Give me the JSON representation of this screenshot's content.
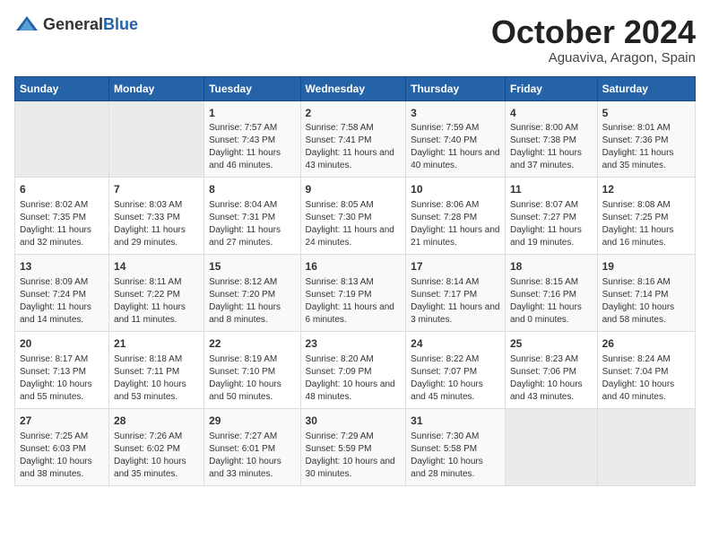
{
  "header": {
    "logo_general": "General",
    "logo_blue": "Blue",
    "month": "October 2024",
    "location": "Aguaviva, Aragon, Spain"
  },
  "days_of_week": [
    "Sunday",
    "Monday",
    "Tuesday",
    "Wednesday",
    "Thursday",
    "Friday",
    "Saturday"
  ],
  "weeks": [
    [
      {
        "day": "",
        "sunrise": "",
        "sunset": "",
        "daylight": ""
      },
      {
        "day": "",
        "sunrise": "",
        "sunset": "",
        "daylight": ""
      },
      {
        "day": "1",
        "sunrise": "Sunrise: 7:57 AM",
        "sunset": "Sunset: 7:43 PM",
        "daylight": "Daylight: 11 hours and 46 minutes."
      },
      {
        "day": "2",
        "sunrise": "Sunrise: 7:58 AM",
        "sunset": "Sunset: 7:41 PM",
        "daylight": "Daylight: 11 hours and 43 minutes."
      },
      {
        "day": "3",
        "sunrise": "Sunrise: 7:59 AM",
        "sunset": "Sunset: 7:40 PM",
        "daylight": "Daylight: 11 hours and 40 minutes."
      },
      {
        "day": "4",
        "sunrise": "Sunrise: 8:00 AM",
        "sunset": "Sunset: 7:38 PM",
        "daylight": "Daylight: 11 hours and 37 minutes."
      },
      {
        "day": "5",
        "sunrise": "Sunrise: 8:01 AM",
        "sunset": "Sunset: 7:36 PM",
        "daylight": "Daylight: 11 hours and 35 minutes."
      }
    ],
    [
      {
        "day": "6",
        "sunrise": "Sunrise: 8:02 AM",
        "sunset": "Sunset: 7:35 PM",
        "daylight": "Daylight: 11 hours and 32 minutes."
      },
      {
        "day": "7",
        "sunrise": "Sunrise: 8:03 AM",
        "sunset": "Sunset: 7:33 PM",
        "daylight": "Daylight: 11 hours and 29 minutes."
      },
      {
        "day": "8",
        "sunrise": "Sunrise: 8:04 AM",
        "sunset": "Sunset: 7:31 PM",
        "daylight": "Daylight: 11 hours and 27 minutes."
      },
      {
        "day": "9",
        "sunrise": "Sunrise: 8:05 AM",
        "sunset": "Sunset: 7:30 PM",
        "daylight": "Daylight: 11 hours and 24 minutes."
      },
      {
        "day": "10",
        "sunrise": "Sunrise: 8:06 AM",
        "sunset": "Sunset: 7:28 PM",
        "daylight": "Daylight: 11 hours and 21 minutes."
      },
      {
        "day": "11",
        "sunrise": "Sunrise: 8:07 AM",
        "sunset": "Sunset: 7:27 PM",
        "daylight": "Daylight: 11 hours and 19 minutes."
      },
      {
        "day": "12",
        "sunrise": "Sunrise: 8:08 AM",
        "sunset": "Sunset: 7:25 PM",
        "daylight": "Daylight: 11 hours and 16 minutes."
      }
    ],
    [
      {
        "day": "13",
        "sunrise": "Sunrise: 8:09 AM",
        "sunset": "Sunset: 7:24 PM",
        "daylight": "Daylight: 11 hours and 14 minutes."
      },
      {
        "day": "14",
        "sunrise": "Sunrise: 8:11 AM",
        "sunset": "Sunset: 7:22 PM",
        "daylight": "Daylight: 11 hours and 11 minutes."
      },
      {
        "day": "15",
        "sunrise": "Sunrise: 8:12 AM",
        "sunset": "Sunset: 7:20 PM",
        "daylight": "Daylight: 11 hours and 8 minutes."
      },
      {
        "day": "16",
        "sunrise": "Sunrise: 8:13 AM",
        "sunset": "Sunset: 7:19 PM",
        "daylight": "Daylight: 11 hours and 6 minutes."
      },
      {
        "day": "17",
        "sunrise": "Sunrise: 8:14 AM",
        "sunset": "Sunset: 7:17 PM",
        "daylight": "Daylight: 11 hours and 3 minutes."
      },
      {
        "day": "18",
        "sunrise": "Sunrise: 8:15 AM",
        "sunset": "Sunset: 7:16 PM",
        "daylight": "Daylight: 11 hours and 0 minutes."
      },
      {
        "day": "19",
        "sunrise": "Sunrise: 8:16 AM",
        "sunset": "Sunset: 7:14 PM",
        "daylight": "Daylight: 10 hours and 58 minutes."
      }
    ],
    [
      {
        "day": "20",
        "sunrise": "Sunrise: 8:17 AM",
        "sunset": "Sunset: 7:13 PM",
        "daylight": "Daylight: 10 hours and 55 minutes."
      },
      {
        "day": "21",
        "sunrise": "Sunrise: 8:18 AM",
        "sunset": "Sunset: 7:11 PM",
        "daylight": "Daylight: 10 hours and 53 minutes."
      },
      {
        "day": "22",
        "sunrise": "Sunrise: 8:19 AM",
        "sunset": "Sunset: 7:10 PM",
        "daylight": "Daylight: 10 hours and 50 minutes."
      },
      {
        "day": "23",
        "sunrise": "Sunrise: 8:20 AM",
        "sunset": "Sunset: 7:09 PM",
        "daylight": "Daylight: 10 hours and 48 minutes."
      },
      {
        "day": "24",
        "sunrise": "Sunrise: 8:22 AM",
        "sunset": "Sunset: 7:07 PM",
        "daylight": "Daylight: 10 hours and 45 minutes."
      },
      {
        "day": "25",
        "sunrise": "Sunrise: 8:23 AM",
        "sunset": "Sunset: 7:06 PM",
        "daylight": "Daylight: 10 hours and 43 minutes."
      },
      {
        "day": "26",
        "sunrise": "Sunrise: 8:24 AM",
        "sunset": "Sunset: 7:04 PM",
        "daylight": "Daylight: 10 hours and 40 minutes."
      }
    ],
    [
      {
        "day": "27",
        "sunrise": "Sunrise: 7:25 AM",
        "sunset": "Sunset: 6:03 PM",
        "daylight": "Daylight: 10 hours and 38 minutes."
      },
      {
        "day": "28",
        "sunrise": "Sunrise: 7:26 AM",
        "sunset": "Sunset: 6:02 PM",
        "daylight": "Daylight: 10 hours and 35 minutes."
      },
      {
        "day": "29",
        "sunrise": "Sunrise: 7:27 AM",
        "sunset": "Sunset: 6:01 PM",
        "daylight": "Daylight: 10 hours and 33 minutes."
      },
      {
        "day": "30",
        "sunrise": "Sunrise: 7:29 AM",
        "sunset": "Sunset: 5:59 PM",
        "daylight": "Daylight: 10 hours and 30 minutes."
      },
      {
        "day": "31",
        "sunrise": "Sunrise: 7:30 AM",
        "sunset": "Sunset: 5:58 PM",
        "daylight": "Daylight: 10 hours and 28 minutes."
      },
      {
        "day": "",
        "sunrise": "",
        "sunset": "",
        "daylight": ""
      },
      {
        "day": "",
        "sunrise": "",
        "sunset": "",
        "daylight": ""
      }
    ]
  ]
}
